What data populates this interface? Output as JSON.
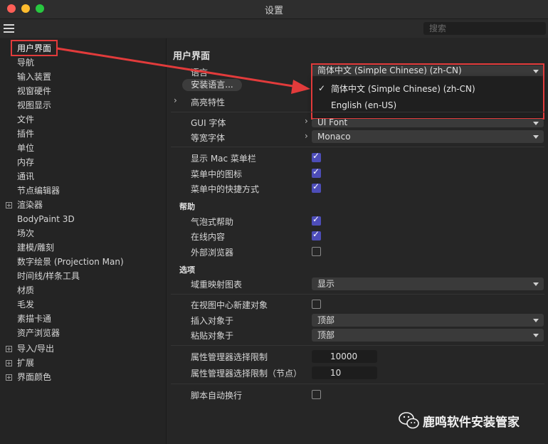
{
  "window": {
    "title": "设置"
  },
  "colors": {
    "accent_red": "#e23b3b",
    "checkbox_on": "#4d4db8",
    "background": "#262626"
  },
  "toolbar": {
    "menu_icon": "hamburger-menu-icon",
    "search_placeholder": "搜索"
  },
  "sidebar": {
    "items": [
      {
        "label": "用户界面",
        "selected": true
      },
      {
        "label": "导航"
      },
      {
        "label": "输入装置"
      },
      {
        "label": "视窗硬件"
      },
      {
        "label": "视图显示"
      },
      {
        "label": "文件"
      },
      {
        "label": "插件"
      },
      {
        "label": "单位"
      },
      {
        "label": "内存"
      },
      {
        "label": "通讯"
      },
      {
        "label": "节点编辑器"
      },
      {
        "label": "渲染器",
        "expandable": true
      },
      {
        "label": "BodyPaint 3D"
      },
      {
        "label": "场次"
      },
      {
        "label": "建模/雕刻"
      },
      {
        "label": "数字绘景 (Projection Man)"
      },
      {
        "label": "时间线/样条工具"
      },
      {
        "label": "材质"
      },
      {
        "label": "毛发"
      },
      {
        "label": "素描卡通"
      },
      {
        "label": "资产浏览器"
      },
      {
        "label": "导入/导出",
        "expandable": true
      },
      {
        "label": "扩展",
        "expandable": true
      },
      {
        "label": "界面颜色",
        "expandable": true
      }
    ]
  },
  "main": {
    "heading": "用户界面",
    "language": {
      "label": "语言",
      "value": "简体中文 (Simple Chinese) (zh-CN)"
    },
    "install_button": "安装语言...",
    "highlight": {
      "label": "高亮特性"
    },
    "language_popup": {
      "options": [
        "简体中文 (Simple Chinese) (zh-CN)",
        "English (en-US)"
      ],
      "selected_index": 0
    },
    "gui_font": {
      "label": "GUI 字体",
      "value": "UI Font"
    },
    "mono_font": {
      "label": "等宽字体",
      "value": "Monaco"
    },
    "checks1": [
      {
        "label": "显示 Mac 菜单栏",
        "checked": true
      },
      {
        "label": "菜单中的图标",
        "checked": true
      },
      {
        "label": "菜单中的快捷方式",
        "checked": true
      }
    ],
    "help_section": "帮助",
    "help_checks": [
      {
        "label": "气泡式帮助",
        "checked": true
      },
      {
        "label": "在线内容",
        "checked": true
      },
      {
        "label": "外部浏览器",
        "checked": false
      }
    ],
    "options_section": "选项",
    "domain_map": {
      "label": "域重映射图表",
      "value": "显示"
    },
    "create_at_center": {
      "label": "在视图中心新建对象",
      "checked": false
    },
    "insert_at": {
      "label": "插入对象于",
      "value": "顶部"
    },
    "paste_at": {
      "label": "粘贴对象于",
      "value": "顶部"
    },
    "attr_limit": {
      "label": "属性管理器选择限制",
      "value": "10000"
    },
    "attr_limit_nodes": {
      "label": "属性管理器选择限制（节点）",
      "value": "10"
    },
    "script_wrap": {
      "label": "脚本自动换行",
      "checked": false
    }
  },
  "footer": {
    "brand": "鹿鸣软件安装管家",
    "logo": "wechat-logo-icon"
  }
}
